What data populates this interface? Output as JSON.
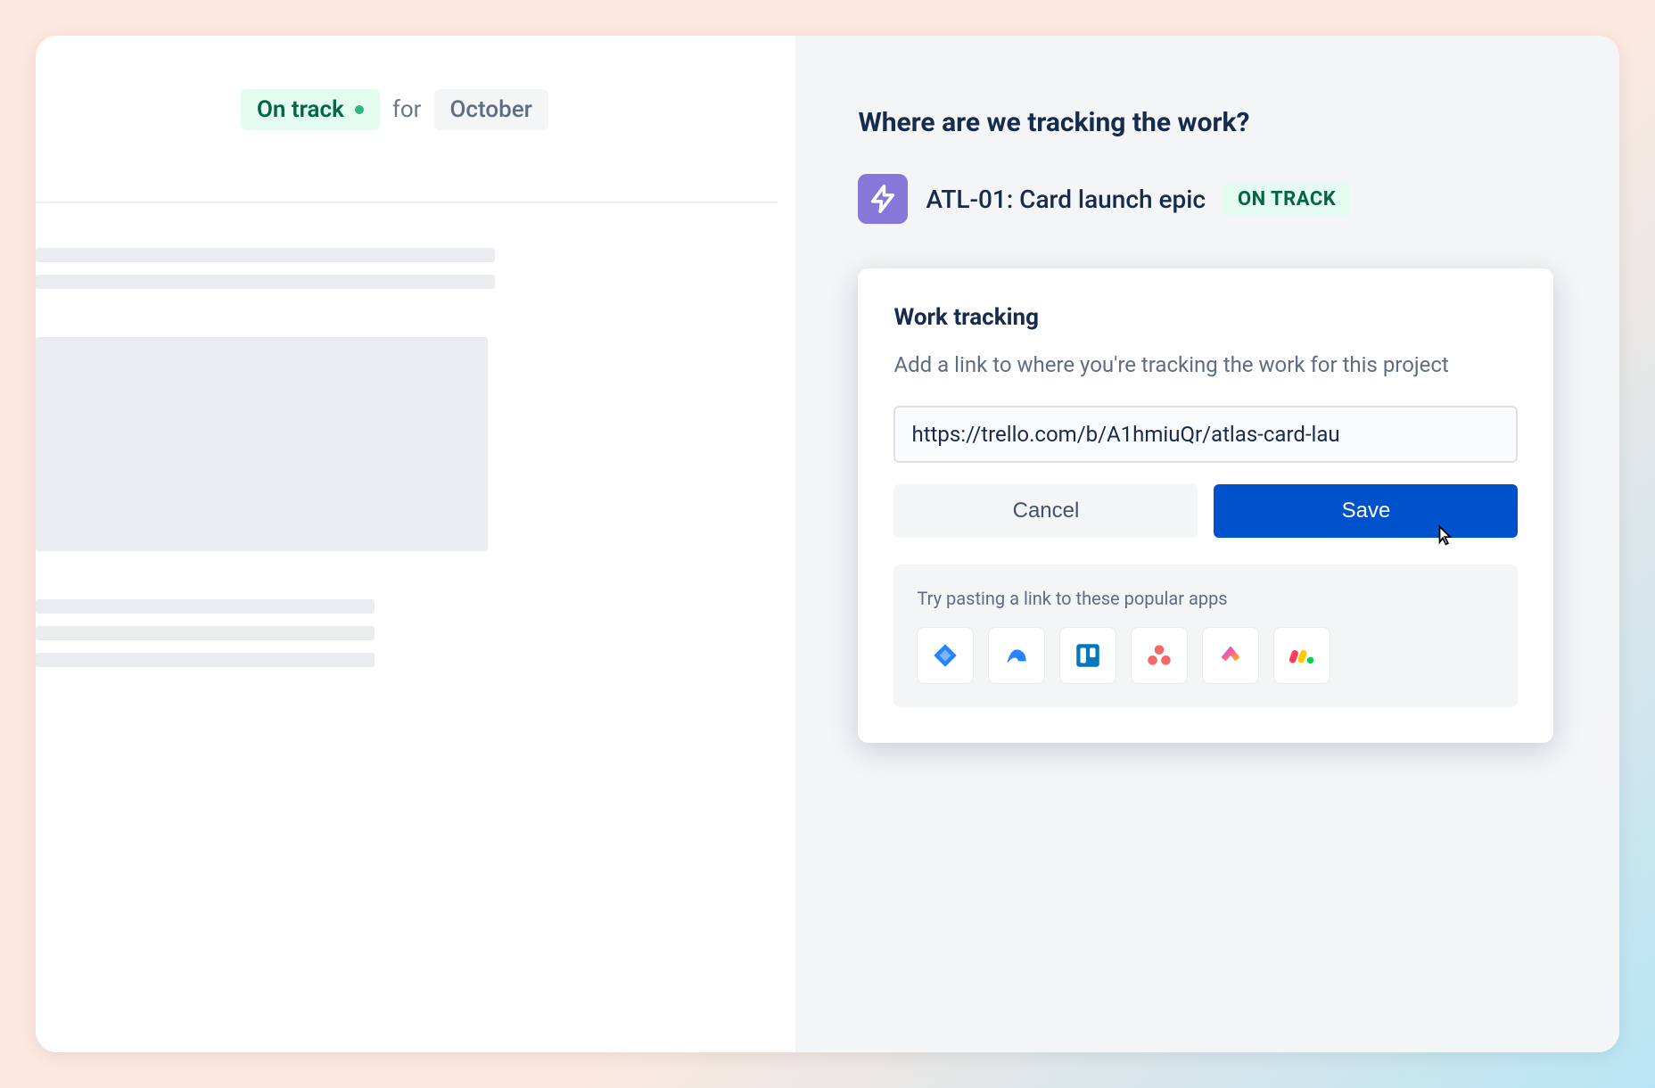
{
  "left": {
    "status_label": "On track",
    "for_label": "for",
    "month": "October"
  },
  "right": {
    "section_title": "Where are we tracking the work?",
    "epic": {
      "title": "ATL-01: Card launch epic",
      "status": "ON TRACK"
    },
    "popover": {
      "title": "Work tracking",
      "description": "Add a link to where you're tracking the work for this project",
      "input_value": "https://trello.com/b/A1hmiuQr/atlas-card-lau",
      "cancel_label": "Cancel",
      "save_label": "Save",
      "apps_label": "Try pasting a link to these popular apps",
      "apps": [
        {
          "name": "jira-icon"
        },
        {
          "name": "jira-work-icon"
        },
        {
          "name": "trello-icon"
        },
        {
          "name": "asana-icon"
        },
        {
          "name": "clickup-icon"
        },
        {
          "name": "monday-icon"
        }
      ]
    }
  }
}
